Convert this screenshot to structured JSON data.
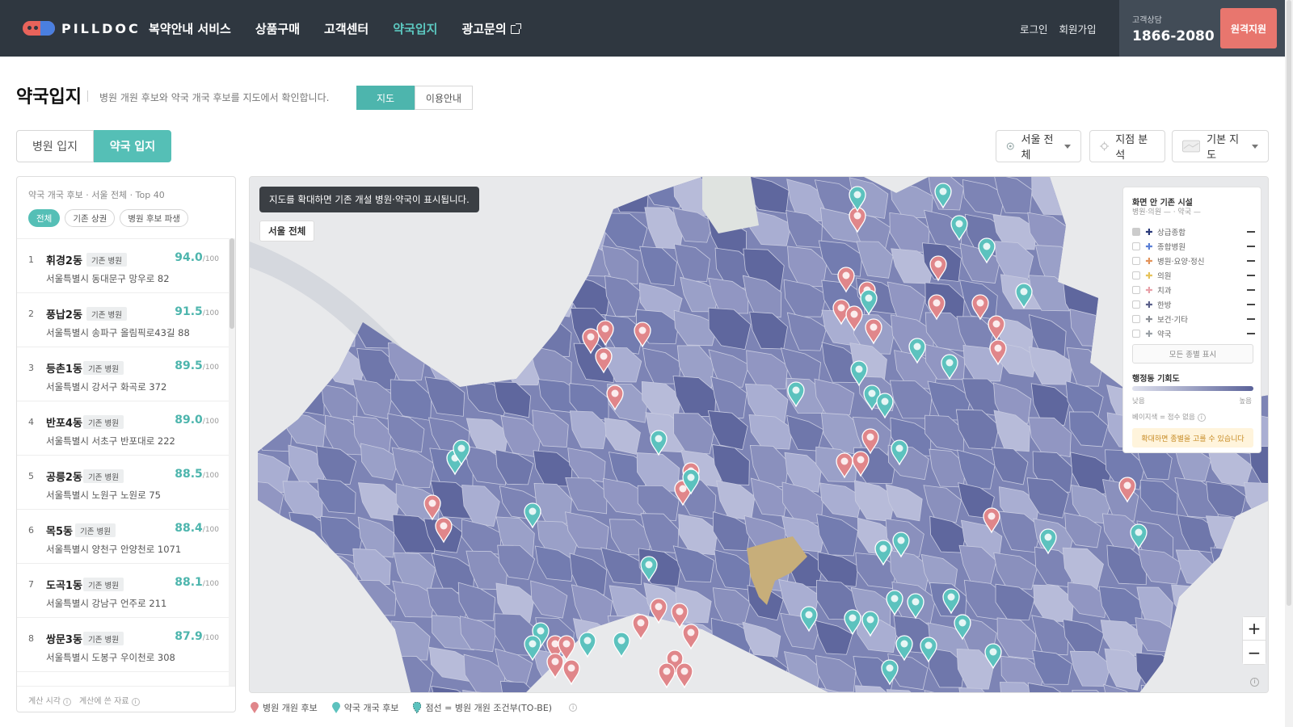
{
  "brand": {
    "name": "PILLDOC"
  },
  "nav": {
    "items": [
      "복약안내 서비스",
      "상품구매",
      "고객센터",
      "약국입지",
      "광고문의"
    ],
    "active_index": 3
  },
  "auth": {
    "login": "로그인",
    "signup": "회원가입"
  },
  "contact": {
    "label": "고객상담",
    "phone": "1866-2080",
    "remote_button": "원격지원"
  },
  "page": {
    "title": "약국입지",
    "description": "병원 개원 후보와 약국 개국 후보를 지도에서 확인합니다.",
    "view_tabs": [
      "지도",
      "이용안내"
    ],
    "view_active": "지도"
  },
  "location_tabs": [
    "병원 입지",
    "약국 입지"
  ],
  "location_active": "약국 입지",
  "tools": {
    "region": "서울 전체",
    "analyze": "지점 분석",
    "map_style": "기본 지도"
  },
  "panel": {
    "header": "약국 개국 후보 · 서울 전체 · Top 40",
    "filters": [
      "전체",
      "기존 상권",
      "병원 후보 파생"
    ],
    "filter_active": "전체",
    "score_suffix": "/100",
    "items": [
      {
        "rank": "1",
        "dong": "휘경2동",
        "tag": "기존 병원",
        "score": "94.0",
        "address": "서울특별시 동대문구 망우로 82"
      },
      {
        "rank": "2",
        "dong": "풍납2동",
        "tag": "기존 병원",
        "score": "91.5",
        "address": "서울특별시 송파구 올림픽로43길 88"
      },
      {
        "rank": "3",
        "dong": "등촌1동",
        "tag": "기존 병원",
        "score": "89.5",
        "address": "서울특별시 강서구 화곡로 372"
      },
      {
        "rank": "4",
        "dong": "반포4동",
        "tag": "기존 병원",
        "score": "89.0",
        "address": "서울특별시 서초구 반포대로 222"
      },
      {
        "rank": "5",
        "dong": "공릉2동",
        "tag": "기존 병원",
        "score": "88.5",
        "address": "서울특별시 노원구 노원로 75"
      },
      {
        "rank": "6",
        "dong": "목5동",
        "tag": "기존 병원",
        "score": "88.4",
        "address": "서울특별시 양천구 안양천로 1071"
      },
      {
        "rank": "7",
        "dong": "도곡1동",
        "tag": "기존 병원",
        "score": "88.1",
        "address": "서울특별시 강남구 언주로 211"
      },
      {
        "rank": "8",
        "dong": "쌍문3동",
        "tag": "기존 병원",
        "score": "87.9",
        "address": "서울특별시 도봉구 우이천로 308"
      }
    ],
    "footer": [
      "계산 시각",
      "계산에 쓴 자료"
    ]
  },
  "map": {
    "tip": "지도를 확대하면 기존 개설 병원·약국이 표시됩니다.",
    "region_chip": "서울 전체",
    "colors": {
      "choropleth_low": "#c5c9e0",
      "choropleth_high": "#4f578f",
      "pharmacy_pin": "#5cc2be",
      "hospital_pin": "#e0868a",
      "highlight": "#c7ae7a"
    },
    "zoom_in": "+",
    "zoom_out": "−"
  },
  "legend": {
    "title": "화면 안 기존 시설",
    "subtitle": "병원·의원 — · 약국 —",
    "items": [
      {
        "label": "상급종합",
        "color": "#2b3a7a",
        "checked": true
      },
      {
        "label": "종합병원",
        "color": "#5a7fd6",
        "checked": false
      },
      {
        "label": "병원·요양·정신",
        "color": "#e3935a",
        "checked": false
      },
      {
        "label": "의원",
        "color": "#e6c35a",
        "checked": false
      },
      {
        "label": "치과",
        "color": "#e8a0a8",
        "checked": false
      },
      {
        "label": "한방",
        "color": "#5a5f8a",
        "checked": false
      },
      {
        "label": "보건·기타",
        "color": "#8b8f96",
        "checked": false
      },
      {
        "label": "약국",
        "color": "#9aa0a6",
        "checked": false
      }
    ],
    "show_all": "모든 종별 표시",
    "choropleth_title": "행정동 기회도",
    "low": "낮음",
    "high": "높음",
    "note": "베이지색 = 점수 없음",
    "warning": "확대하면 종별을 고를 수 있습니다"
  },
  "bottom_legend": {
    "hospital": "병원 개원 후보",
    "pharmacy": "약국 개국 후보",
    "dotted": "점선 = 병원 개원 조건부(TO-BE)"
  }
}
